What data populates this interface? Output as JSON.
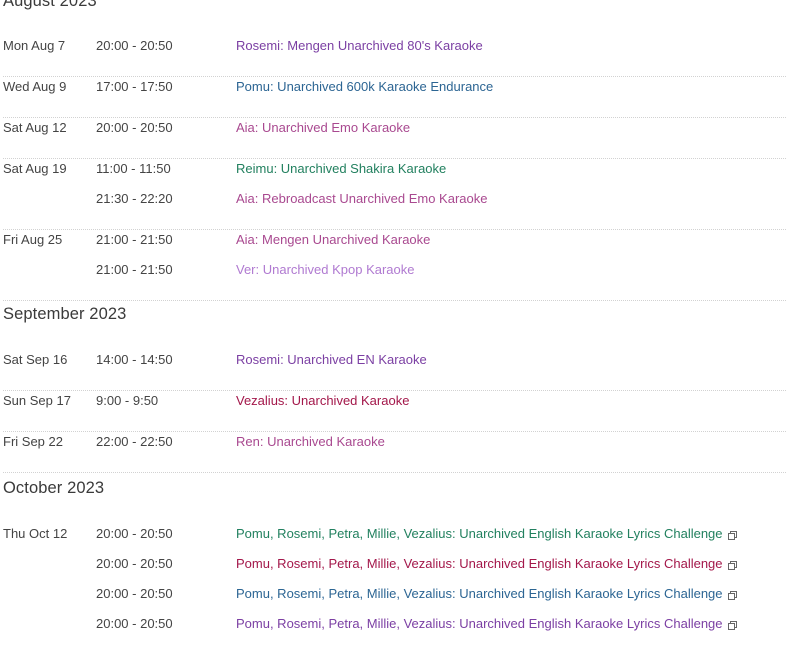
{
  "colors": {
    "purple": "#7b3fa3",
    "blue": "#2c6593",
    "pink": "#a94990",
    "green": "#22805f",
    "crimson": "#a3174a",
    "lavender": "#b07ad1",
    "text": "#444444",
    "heading": "#3a3a3a",
    "divider": "#d2d2d2"
  },
  "months": [
    {
      "heading": "August 2023",
      "entries": [
        {
          "date": "Mon Aug 7",
          "streams": [
            {
              "time": "20:00 - 20:50",
              "title": "Rosemi: Mengen Unarchived 80's Karaoke",
              "color": "purple"
            }
          ]
        },
        {
          "date": "Wed Aug 9",
          "streams": [
            {
              "time": "17:00 - 17:50",
              "title": "Pomu: Unarchived 600k Karaoke Endurance",
              "color": "blue"
            }
          ]
        },
        {
          "date": "Sat Aug 12",
          "streams": [
            {
              "time": "20:00 - 20:50",
              "title": "Aia: Unarchived Emo Karaoke",
              "color": "pink"
            }
          ]
        },
        {
          "date": "Sat Aug 19",
          "streams": [
            {
              "time": "11:00 - 11:50",
              "title": "Reimu: Unarchived Shakira Karaoke",
              "color": "green"
            },
            {
              "time": "21:30 - 22:20",
              "title": "Aia: Rebroadcast Unarchived Emo Karaoke",
              "color": "pink"
            }
          ]
        },
        {
          "date": "Fri Aug 25",
          "streams": [
            {
              "time": "21:00 - 21:50",
              "title": "Aia: Mengen Unarchived Karaoke",
              "color": "pink"
            },
            {
              "time": "21:00 - 21:50",
              "title": "Ver: Unarchived Kpop Karaoke",
              "color": "lavender"
            }
          ]
        }
      ]
    },
    {
      "heading": "September 2023",
      "entries": [
        {
          "date": "Sat Sep 16",
          "streams": [
            {
              "time": "14:00 - 14:50",
              "title": "Rosemi: Unarchived EN Karaoke",
              "color": "purple"
            }
          ]
        },
        {
          "date": "Sun Sep 17",
          "streams": [
            {
              "time": "9:00 - 9:50",
              "title": "Vezalius: Unarchived Karaoke",
              "color": "crimson"
            }
          ]
        },
        {
          "date": "Fri Sep 22",
          "streams": [
            {
              "time": "22:00 - 22:50",
              "title": "Ren: Unarchived Karaoke",
              "color": "pink"
            }
          ]
        }
      ]
    },
    {
      "heading": "October 2023",
      "entries": [
        {
          "date": "Thu Oct 12",
          "streams": [
            {
              "time": "20:00 - 20:50",
              "title": "Pomu, Rosemi, Petra, Millie, Vezalius: Unarchived English Karaoke Lyrics Challenge",
              "color": "green",
              "icon": "external-link-icon"
            },
            {
              "time": "20:00 - 20:50",
              "title": "Pomu, Rosemi, Petra, Millie, Vezalius: Unarchived English Karaoke Lyrics Challenge",
              "color": "crimson",
              "icon": "external-link-icon"
            },
            {
              "time": "20:00 - 20:50",
              "title": "Pomu, Rosemi, Petra, Millie, Vezalius: Unarchived English Karaoke Lyrics Challenge",
              "color": "blue",
              "icon": "external-link-icon"
            },
            {
              "time": "20:00 - 20:50",
              "title": "Pomu, Rosemi, Petra, Millie, Vezalius: Unarchived English Karaoke Lyrics Challenge",
              "color": "purple",
              "icon": "external-link-icon"
            }
          ]
        }
      ]
    }
  ]
}
